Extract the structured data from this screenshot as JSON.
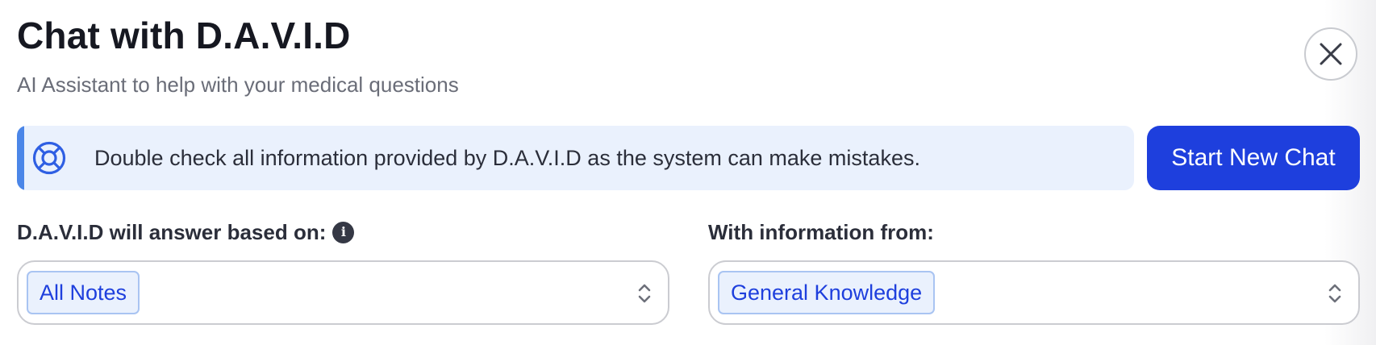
{
  "header": {
    "title": "Chat with D.A.V.I.D",
    "subtitle": "AI Assistant to help with your medical questions"
  },
  "close_button": {
    "icon": "close-icon"
  },
  "banner": {
    "icon": "lifebuoy-icon",
    "message": "Double check all information provided by D.A.V.I.D as the system can make mistakes.",
    "accent_color": "#4b86e8",
    "background_color": "#eaf1fd"
  },
  "actions": {
    "start_new_chat_label": "Start New Chat",
    "button_color": "#1e3fdd"
  },
  "answer_based_on": {
    "label": "D.A.V.I.D will answer based on:",
    "info_icon": "info-icon",
    "selected": "All Notes"
  },
  "information_from": {
    "label": "With information from:",
    "selected": "General Knowledge"
  }
}
